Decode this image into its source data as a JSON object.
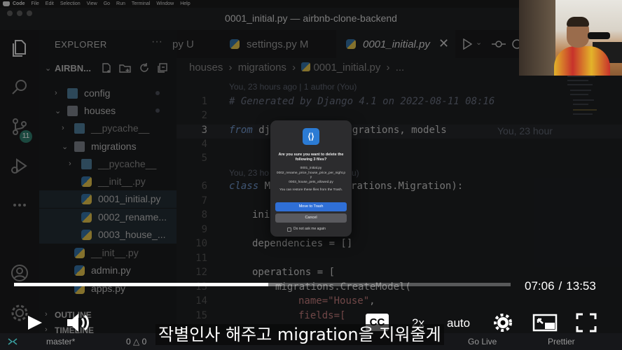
{
  "menubar": {
    "app": "Code",
    "items": [
      "File",
      "Edit",
      "Selection",
      "View",
      "Go",
      "Run",
      "Terminal",
      "Window",
      "Help"
    ]
  },
  "window": {
    "title": "0001_initial.py — airbnb-clone-backend"
  },
  "activitybar": {
    "scm_badge": "11"
  },
  "sidebar": {
    "title": "EXPLORER",
    "more": "···",
    "root": "AIRBN...",
    "tree": [
      "config",
      "houses",
      "__pycache__",
      "migrations",
      "__pycache__",
      "__init__.py",
      "0001_initial.py",
      "0002_rename...",
      "0003_house_...",
      "__init__.py",
      "admin.py",
      "apps.py"
    ],
    "outline": "OUTLINE",
    "timeline": "TIMELINE"
  },
  "tabs": [
    {
      "label": "py U"
    },
    {
      "label": "settings.py M"
    },
    {
      "label": "0001_initial.py"
    }
  ],
  "breadcrumb": [
    "houses",
    "migrations",
    "0001_initial.py",
    "..."
  ],
  "code": {
    "blame_top": "You, 23 hours ago | 1 author (You)",
    "comment": "# Generated by Django 4.1 on 2022-08-11 08:16",
    "line3_kw": "from",
    "line3_a": "dj",
    "line3_b": "migrations, models",
    "line3_blame": "You, 23 hour",
    "blame_mid": "You, 23 ho",
    "blame_mid_end": "u)",
    "line6_kw": "class",
    "line6_a": "M",
    "line6_b": "rations.Migration):",
    "line8": "ini",
    "line10": "dependencies = []",
    "line12": "operations = [",
    "line13": "migrations.CreateModel(",
    "line14_a": "name=",
    "line14_str": "\"House\"",
    "line14_b": ",",
    "line15": "fields=[",
    "line_numbers": [
      "1",
      "2",
      "3",
      "4",
      "5",
      "6",
      "7",
      "8",
      "9",
      "10",
      "11",
      "12",
      "13",
      "14",
      "15"
    ]
  },
  "dialog": {
    "title": "Are you sure you want to delete the following 3 files?",
    "files": [
      "0001_initial.py",
      "0002_rename_price_house_price_per_night.py",
      "0003_house_pets_allowed.py"
    ],
    "message": "You can restore these files from the Trash.",
    "confirm": "Move to Trash",
    "cancel": "Cancel",
    "checkbox": "Do not ask me again"
  },
  "player": {
    "current_time": "07:06",
    "separator": "/",
    "duration": "13:53",
    "progress": 0.512,
    "buffered": 0.54,
    "cc": "CC",
    "speed": "2x",
    "quality": "auto",
    "subtitle": "작별인사 해주고 migration을 지워줄게"
  },
  "statusbar": {
    "branch": "master*",
    "counts": "0 △ 0",
    "golive": "Go Live",
    "prettier": "Prettier"
  }
}
